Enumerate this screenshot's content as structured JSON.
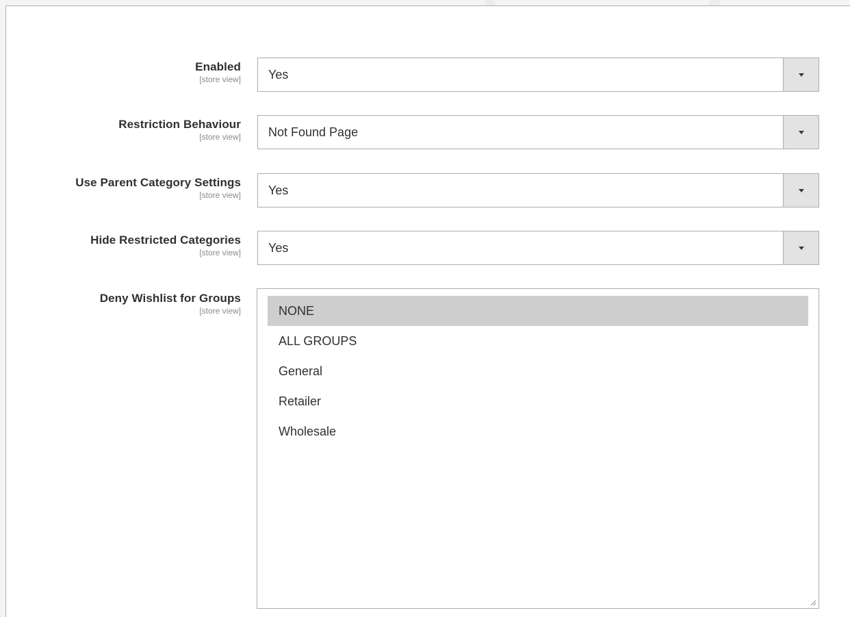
{
  "form": {
    "fields": [
      {
        "label": "Enabled",
        "scope": "[store view]",
        "value": "Yes"
      },
      {
        "label": "Restriction Behaviour",
        "scope": "[store view]",
        "value": "Not Found Page"
      },
      {
        "label": "Use Parent Category Settings",
        "scope": "[store view]",
        "value": "Yes"
      },
      {
        "label": "Hide Restricted Categories",
        "scope": "[store view]",
        "value": "Yes"
      }
    ],
    "wishlist": {
      "label": "Deny Wishlist for Groups",
      "scope": "[store view]",
      "options": [
        "NONE",
        "ALL GROUPS",
        "General",
        "Retailer",
        "Wholesale"
      ],
      "selected": "NONE"
    }
  },
  "colors": {
    "selected_option_bg": "#cecece",
    "border": "#adadad",
    "label_text": "#303030",
    "scope_text": "#8a8a8a",
    "dropdown_button_bg": "#e3e3e3"
  },
  "icons": {
    "dropdown": "chevron-down-icon",
    "resize": "resize-grip-icon"
  }
}
